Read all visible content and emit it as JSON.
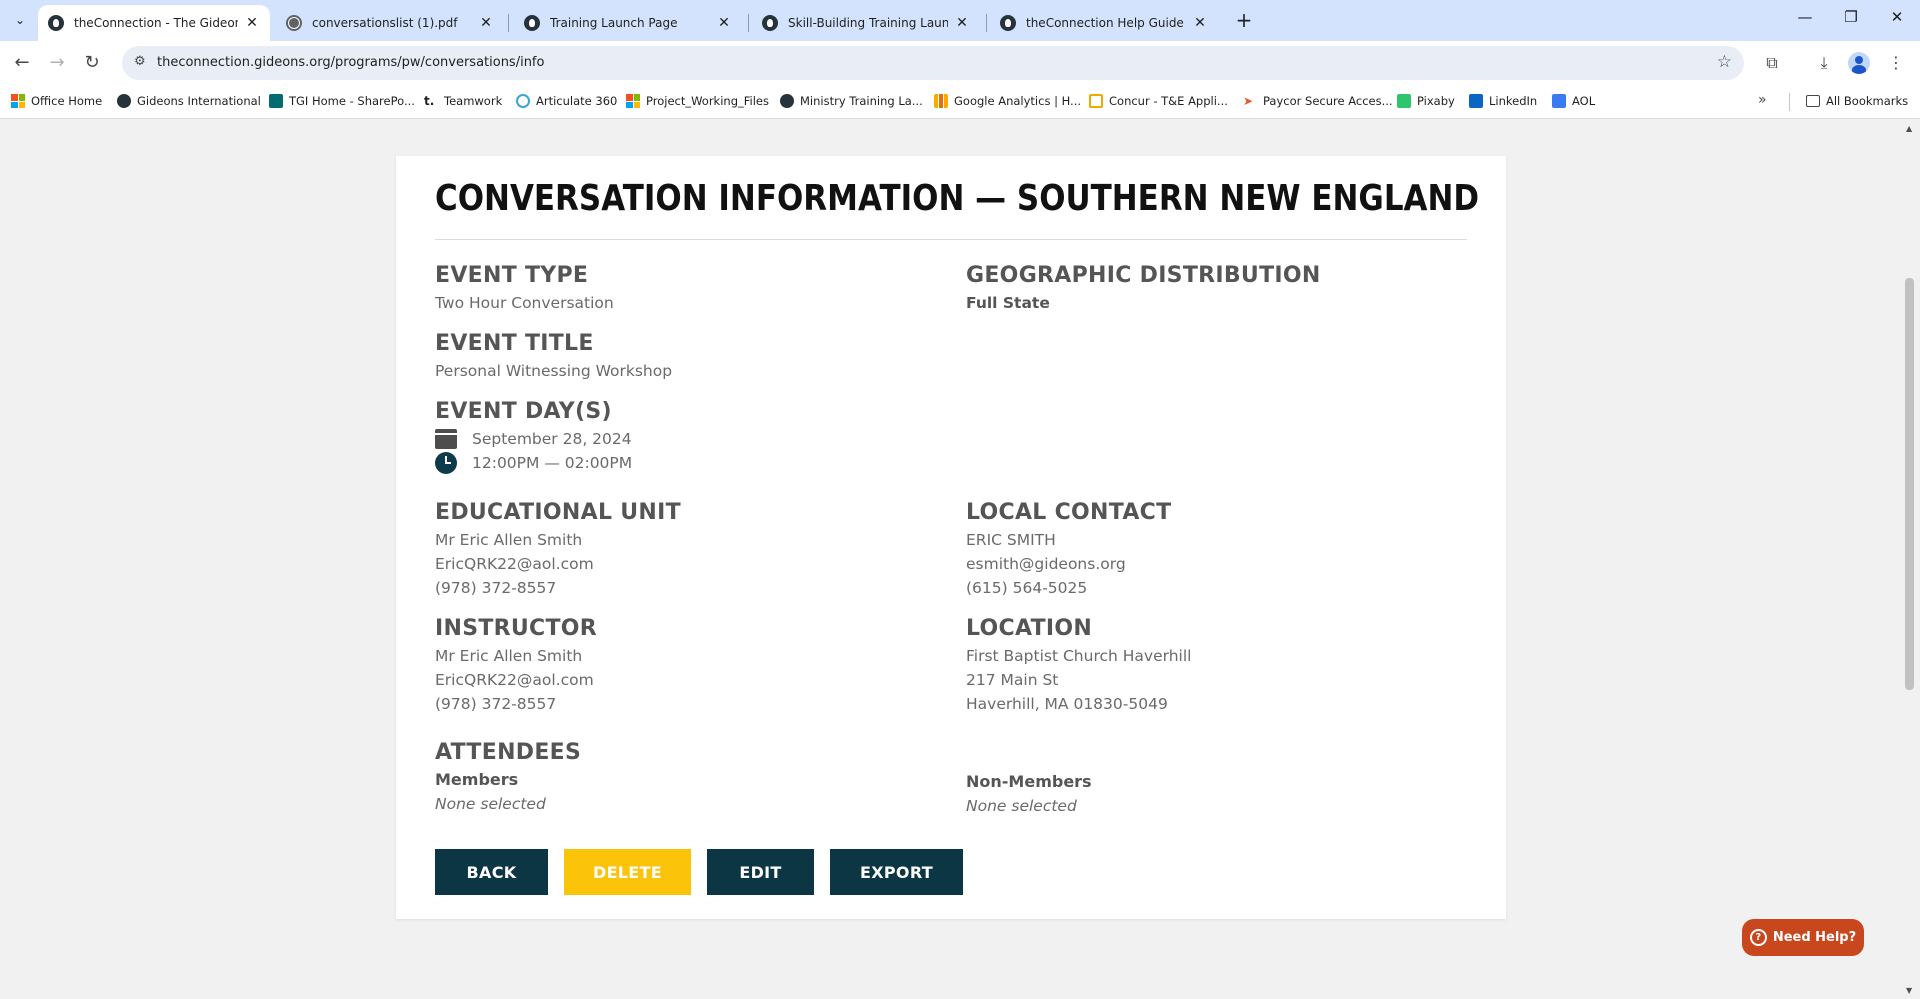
{
  "browser": {
    "tabs": [
      {
        "title": "theConnection - The Gideons In",
        "active": true,
        "favicon": "gideons-icon"
      },
      {
        "title": "conversationslist (1).pdf",
        "active": false,
        "favicon": "globe-icon"
      },
      {
        "title": "Training Launch Page",
        "active": false,
        "favicon": "gideons-icon"
      },
      {
        "title": "Skill-Building Training Launch P",
        "active": false,
        "favicon": "gideons-icon"
      },
      {
        "title": "theConnection Help Guide - Ov",
        "active": false,
        "favicon": "gideons-icon"
      }
    ],
    "url": "theconnection.gideons.org/programs/pw/conversations/info",
    "bookmarks": [
      "Office Home",
      "Gideons International",
      "TGI Home - SharePo...",
      "Teamwork",
      "Articulate 360",
      "Project_Working_Files",
      "Ministry Training La...",
      "Google Analytics | H...",
      "Concur - T&E Appli...",
      "Paycor Secure Acces...",
      "Pixaby",
      "LinkedIn",
      "AOL"
    ],
    "all_bookmarks_label": "All Bookmarks"
  },
  "page": {
    "title": "CONVERSATION INFORMATION — SOUTHERN NEW ENGLAND",
    "event_type": {
      "label": "EVENT TYPE",
      "value": "Two Hour Conversation"
    },
    "geographic_distribution": {
      "label": "GEOGRAPHIC DISTRIBUTION",
      "value": "Full State"
    },
    "event_title": {
      "label": "EVENT TITLE",
      "value": "Personal Witnessing Workshop"
    },
    "event_days": {
      "label": "EVENT DAY(S)",
      "date": "September 28, 2024",
      "time": "12:00PM — 02:00PM"
    },
    "educational_unit": {
      "label": "EDUCATIONAL UNIT",
      "name": "Mr Eric Allen Smith",
      "email": "EricQRK22@aol.com",
      "phone": "(978) 372-8557"
    },
    "local_contact": {
      "label": "LOCAL CONTACT",
      "name": "ERIC SMITH",
      "email": "esmith@gideons.org",
      "phone": "(615) 564-5025"
    },
    "instructor": {
      "label": "INSTRUCTOR",
      "name": "Mr Eric Allen Smith",
      "email": "EricQRK22@aol.com",
      "phone": "(978) 372-8557"
    },
    "location": {
      "label": "LOCATION",
      "line1": "First Baptist Church Haverhill",
      "line2": "217 Main St",
      "line3": "Haverhill, MA 01830-5049"
    },
    "attendees": {
      "label": "ATTENDEES",
      "members_label": "Members",
      "members_value": "None selected",
      "nonmembers_label": "Non-Members",
      "nonmembers_value": "None selected"
    },
    "buttons": {
      "back": "BACK",
      "delete": "DELETE",
      "edit": "EDIT",
      "export": "EXPORT"
    },
    "help": "Need Help?"
  },
  "colors": {
    "primary_dark": "#0d3644",
    "delete_yellow": "#fbc30a",
    "help_orange": "#c8471d"
  }
}
